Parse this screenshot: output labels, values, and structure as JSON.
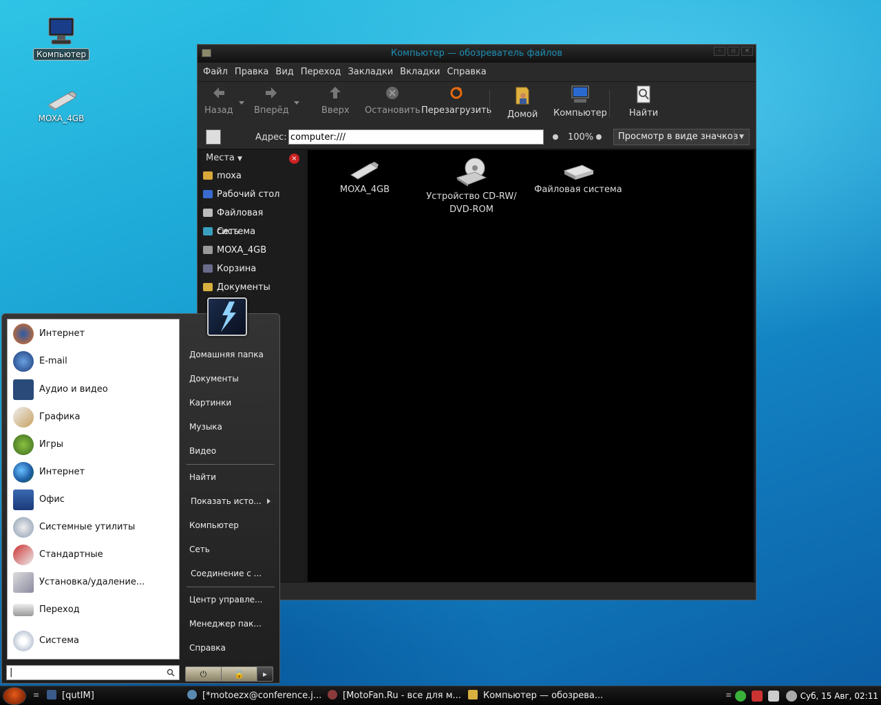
{
  "desktop": {
    "icons": [
      {
        "label": "Компьютер"
      },
      {
        "label": "MOXA_4GB"
      }
    ]
  },
  "file_manager": {
    "title": "Компьютер — обозреватель файлов",
    "menu": [
      "Файл",
      "Правка",
      "Вид",
      "Переход",
      "Закладки",
      "Вкладки",
      "Справка"
    ],
    "toolbar": {
      "back": "Назад",
      "forward": "Вперёд",
      "up": "Вверх",
      "stop": "Остановить",
      "reload": "Перезагрузить",
      "home": "Домой",
      "computer": "Компьютер",
      "find": "Найти"
    },
    "address_label": "Адрес:",
    "address_value": "computer:///",
    "zoom": "100%",
    "view_mode": "Просмотр в виде значков",
    "sidebar": {
      "header": "Места",
      "items": [
        "moxa",
        "Рабочий стол",
        "Файловая система",
        "Сеть",
        "MOXA_4GB",
        "Корзина",
        "Документы"
      ]
    },
    "items": [
      {
        "label": "MOXA_4GB"
      },
      {
        "label": "Устройство CD-RW/ DVD-ROM"
      },
      {
        "label": "Файловая система"
      }
    ]
  },
  "start_menu": {
    "apps": [
      "Интернет",
      "E-mail",
      "Аудио и видео",
      "Графика",
      "Игры",
      "Интернет",
      "Офис",
      "Системные утилиты",
      "Стандартные",
      "Установка/удаление...",
      "Переход",
      "Система"
    ],
    "places": [
      "Домашняя папка",
      "Документы",
      "Картинки",
      "Музыка",
      "Видео"
    ],
    "actions": [
      "Найти",
      "Показать исто...",
      "Компьютер",
      "Сеть",
      "Соединение с ..."
    ],
    "system": [
      "Центр управле...",
      "Менеджер пак...",
      "Справка"
    ]
  },
  "taskbar": {
    "tasks": [
      "[qutIM]",
      "[*motoezx@conference.j...",
      "[MotoFan.Ru - все для м...",
      "Компьютер — обозрева..."
    ],
    "clock": "Суб, 15 Авг, 02:11"
  },
  "colors": {
    "title_text": "#1d8fb5",
    "window_bg": "#1a1a1a",
    "content_bg": "#000000",
    "start_orb": "#e85a1a"
  }
}
